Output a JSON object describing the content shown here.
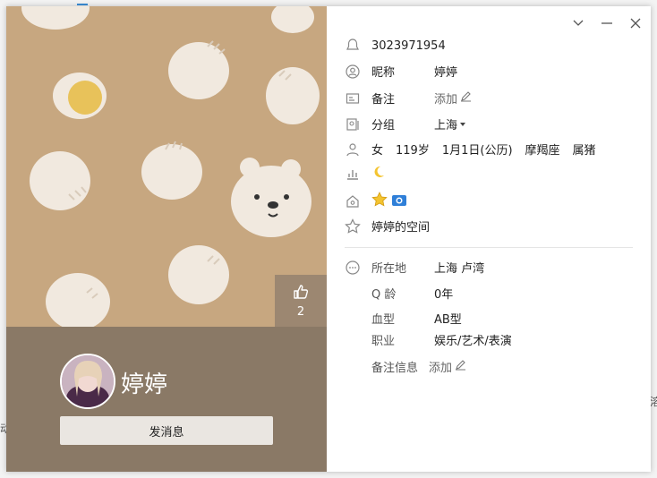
{
  "background": {
    "left_edge_text": "动",
    "right_edge_text": "溶"
  },
  "cover": {
    "likes": "2"
  },
  "profile": {
    "display_name": "婷婷",
    "message_button": "发消息"
  },
  "info": {
    "qq_number": "3023971954",
    "nickname_label": "昵称",
    "nickname": "婷婷",
    "remark_label": "备注",
    "remark_action": "添加",
    "group_label": "分组",
    "group_value": "上海",
    "gender": "女",
    "age": "119岁",
    "birthday": "1月1日(公历)",
    "constellation": "摩羯座",
    "zodiac": "属猪",
    "space_link": "婷婷的空间",
    "location_label": "所在地",
    "location": "上海 卢湾",
    "qage_label": "Q 龄",
    "qage": "0年",
    "blood_label": "血型",
    "blood": "AB型",
    "job_label": "职业",
    "job": "娱乐/艺术/表演",
    "remark_info_label": "备注信息",
    "remark_info_action": "添加"
  },
  "colors": {
    "cover_bg": "#c7a780",
    "band_bg": "#8a7966",
    "accent_star": "#f4c430",
    "accent_blue": "#2f7fd8"
  }
}
